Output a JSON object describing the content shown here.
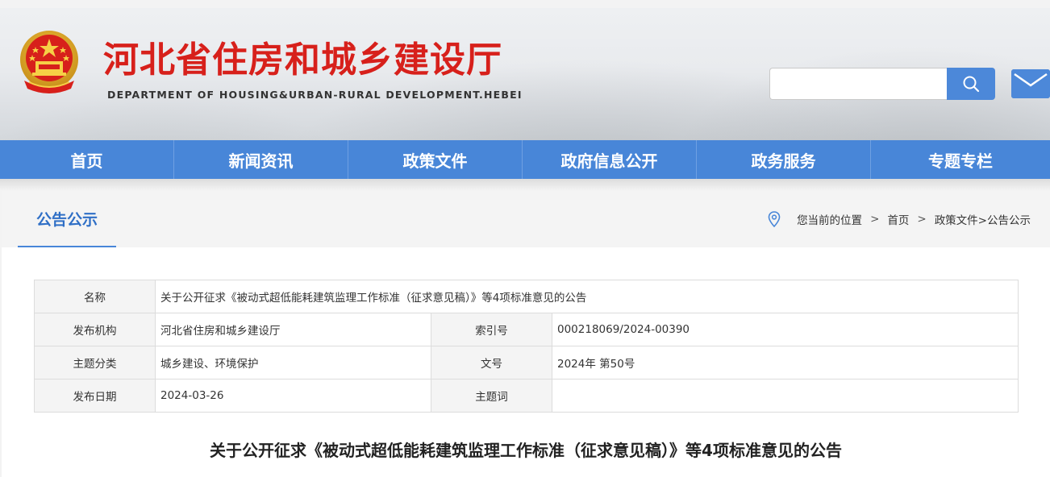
{
  "header": {
    "site_title": "河北省住房和城乡建设厅",
    "site_subtitle": "DEPARTMENT OF HOUSING&URBAN-RURAL DEVELOPMENT.HEBEI",
    "search_value": "",
    "emblem_icon": "national-emblem-icon",
    "search_icon": "search-icon",
    "mail_icon": "mail-icon"
  },
  "nav": {
    "items": [
      {
        "label": "首页"
      },
      {
        "label": "新闻资讯"
      },
      {
        "label": "政策文件"
      },
      {
        "label": "政府信息公开"
      },
      {
        "label": "政务服务"
      },
      {
        "label": "专题专栏"
      }
    ]
  },
  "section": {
    "title": "公告公示"
  },
  "breadcrumb": {
    "prefix": "您当前的位置",
    "home": "首页",
    "separator": ">",
    "trail": "政策文件>公告公示"
  },
  "info_table": {
    "name_label": "名称",
    "name_value": "关于公开征求《被动式超低能耗建筑监理工作标准（征求意见稿）》等4项标准意见的公告",
    "publisher_label": "发布机构",
    "publisher_value": "河北省住房和城乡建设厅",
    "index_label": "索引号",
    "index_value": "000218069/2024-00390",
    "category_label": "主题分类",
    "category_value": "城乡建设、环境保护",
    "doc_no_label": "文号",
    "doc_no_value": "2024年 第50号",
    "date_label": "发布日期",
    "date_value": "2024-03-26",
    "keywords_label": "主题词",
    "keywords_value": ""
  },
  "article": {
    "title": "关于公开征求《被动式超低能耗建筑监理工作标准（征求意见稿）》等4项标准意见的公告"
  },
  "colors": {
    "brand_red": "#d7201b",
    "nav_blue": "#4886d8",
    "tab_blue": "#2f6fc6"
  }
}
